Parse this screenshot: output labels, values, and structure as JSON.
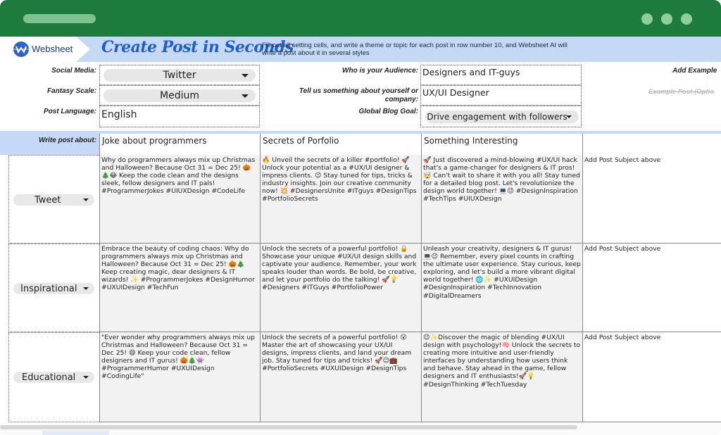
{
  "window": {
    "dots": 3
  },
  "banner": {
    "logo_text": "Websheet",
    "title": "Create Post in Seconds",
    "description": "Fill out all setting cells, and write a theme or topic for each post in row number 10, and Websheet AI will write a post about it in several styles"
  },
  "settings": {
    "social_media": {
      "label": "Social Media:",
      "value": "Twitter"
    },
    "fantasy_scale": {
      "label": "Fantasy Scale:",
      "value": "Medium"
    },
    "post_language": {
      "label": "Post Language:",
      "value": "English"
    },
    "audience": {
      "label": "Who is your Audience:",
      "value": "Designers and IT-guys"
    },
    "about": {
      "label": "Tell us something about yourself or company:",
      "value": "UX/UI Designer"
    },
    "goal": {
      "label": "Global Blog Goal:",
      "value": "Drive engagement with followers"
    },
    "add_example": {
      "label": "Add Example"
    },
    "example_post": {
      "label": "Example Post (Optio"
    }
  },
  "subjects": {
    "label": "Write post about:",
    "items": [
      "Joke about programmers",
      "Secrets of Porfolio",
      "Something Interesting",
      ""
    ]
  },
  "rows": [
    {
      "style": "Tweet",
      "posts": [
        "Why do programmers always mix up Christmas and Halloween? Because Oct 31 = Dec 25! 🎃🎄😂 Keep the code clean and the designs sleek, fellow designers and IT pals! #ProgrammerJokes #UIUXDesign #CodeLife",
        "🔥 Unveil the secrets of a killer #portfolio! 🚀 Unlock your potential as a #UX/UI designer & impress clients. 😉 Stay tuned for tips, tricks & industry insights. Join our creative community now! 💥 #DesignersUnite #ITguys #DesignTips #PortfolioSecrets",
        "🚀 Just discovered a mind-blowing #UX/UI hack that's a game-changer for designers & IT pros! 🤯 Can't wait to share it with you all! Stay tuned for a detailed blog post. Let's revolutionize the design world together! 💻😉 #DesignInspiration #TechTips #UIUXDesign",
        "Add Post Subject above"
      ]
    },
    {
      "style": "Inspirational",
      "posts": [
        "Embrace the beauty of coding chaos: Why do programmers always mix up Christmas and Halloween? Because Oct 31 = Dec 25! 🎃🎄 Keep creating magic, dear designers & IT wizards! ✨ #ProgrammerJokes #DesignHumor #UXUIDesign #TechFun",
        "Unlock the secrets of a powerful portfolio! 🔒 Showcase your unique #UX/UI design skills and captivate your audience. Remember, your work speaks louder than words. Be bold, be creative, and let your portfolio do the talking! 🚀💡 #Designers #ITGuys #PortfolioPower",
        "Unleash your creativity, designers & IT gurus! 💻😉 Remember, every pixel counts in crafting the ultimate user experience. Stay curious, keep exploring, and let's build a more vibrant digital world together! 🌐✨ #UXUIDesign #DesignInspiration #TechInnovation #DigitalDreamers",
        "Add Post Subject above"
      ]
    },
    {
      "style": "Educational",
      "posts": [
        "\"Ever wonder why programmers always mix up Christmas and Halloween? Because Oct 31 = Dec 25! 😄 Keep your code clean, fellow designers and IT gurus! 🎃🎄👾 #ProgrammerHumor #UXUIDesign #CodingLife\"",
        "Unlock the secrets of a powerful portfolio! 😮 Master the art of showcasing your UX/UI designs, impress clients, and land your dream job. Stay tuned for tips and tricks! 🚀😉💼 #PortfolioSecrets #UXUIDesign #DesignTips",
        "😉✨Discover the magic of blending #UX/UI design with psychology!🧠 Unlock the secrets to creating more intuitive and user-friendly interfaces by understanding how users think and behave. Stay ahead in the game, fellow designers and IT enthusiasts!🚀💡 #DesignThinking #TechTuesday",
        "Add Post Subject above"
      ]
    }
  ]
}
